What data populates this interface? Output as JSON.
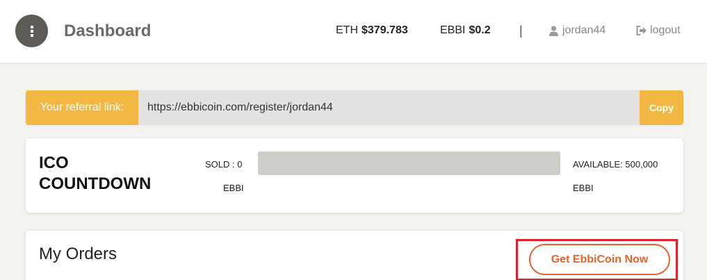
{
  "header": {
    "title": "Dashboard",
    "menu_icon": "menu-dots-icon",
    "eth_label": "ETH",
    "eth_price": "$379.783",
    "ebbi_label": "EBBI",
    "ebbi_price": "$0.2",
    "separator": "|",
    "username": "jordan44",
    "logout_label": "logout"
  },
  "referral": {
    "label": "Your referral link:",
    "url": "https://ebbicoin.com/register/jordan44",
    "copy_label": "Copy"
  },
  "ico": {
    "title": "ICO COUNTDOWN",
    "sold_label": "SOLD : 0",
    "sold_unit": "EBBI",
    "available_label": "AVAILABLE: 500,000",
    "available_unit": "EBBI",
    "progress_fraction": 0
  },
  "orders": {
    "title": "My Orders",
    "cta_label": "Get EbbiCoin Now"
  },
  "colors": {
    "accent_yellow": "#f2b843",
    "cta_orange": "#e8622c",
    "highlight_red": "#e0202a"
  }
}
